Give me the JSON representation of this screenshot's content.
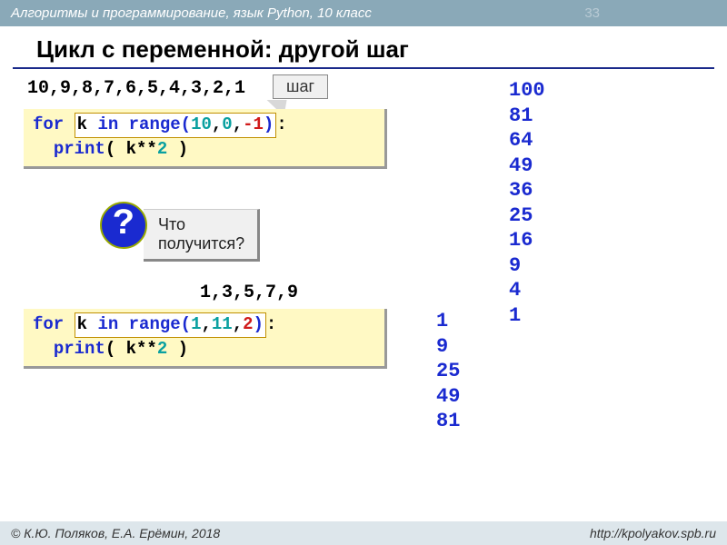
{
  "header": "Алгоритмы и программирование, язык Python, 10 класс",
  "pageNumber": "33",
  "title": "Цикл с переменной: другой шаг",
  "seq1": "10,9,8,7,6,5,4,3,2,1",
  "stepLabel": "шаг",
  "code1": {
    "for": "for",
    "k": "k",
    "in": "in",
    "range": "range(",
    "a": "10",
    "c1": ",",
    "b": "0",
    "c2": ",",
    "step": "-1",
    "close": ")",
    "colon": ":",
    "print": "print",
    "body": "( k**",
    "two": "2",
    "body2": " )"
  },
  "question": {
    "mark": "?",
    "text": "Что получится?"
  },
  "seq2": "1,3,5,7,9",
  "code2": {
    "for": "for",
    "k": "k",
    "in": "in",
    "range": "range(",
    "a": "1",
    "c1": ",",
    "b": "11",
    "c2": ",",
    "step": "2",
    "close": ")",
    "colon": ":",
    "print": "print",
    "body": "( k**",
    "two": "2",
    "body2": " )"
  },
  "output1": [
    "100",
    "81",
    "64",
    "49",
    "36",
    "25",
    "16",
    "9",
    "4",
    "1"
  ],
  "output2": [
    "1",
    "9",
    "25",
    "49",
    "81"
  ],
  "footerLeft": "© К.Ю. Поляков, Е.А. Ерёмин, 2018",
  "footerRight": "http://kpolyakov.spb.ru"
}
